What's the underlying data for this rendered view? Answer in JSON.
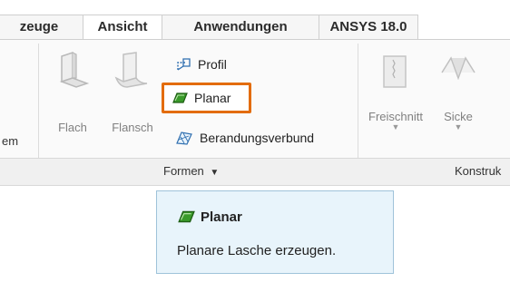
{
  "tabs": [
    {
      "label": "zeuge"
    },
    {
      "label": "Ansicht"
    },
    {
      "label": "Anwendungen"
    },
    {
      "label": "ANSYS 18.0"
    }
  ],
  "ribbon": {
    "partial_left_label": "em",
    "buttons": {
      "flach": "Flach",
      "flansch": "Flansch",
      "profil": "Profil",
      "planar": "Planar",
      "berandungsverbund": "Berandungsverbund",
      "freischnitt": "Freischnitt",
      "sicke": "Sicke"
    },
    "groups": {
      "formen": "Formen",
      "formen_arrow": "▼",
      "konstruk": "Konstruk"
    }
  },
  "tooltip": {
    "title": "Planar",
    "description": "Planare Lasche erzeugen."
  },
  "colors": {
    "highlight": "#e36c0a",
    "icon_green": "#3a9a2a",
    "tooltip_bg": "#e8f4fb"
  }
}
